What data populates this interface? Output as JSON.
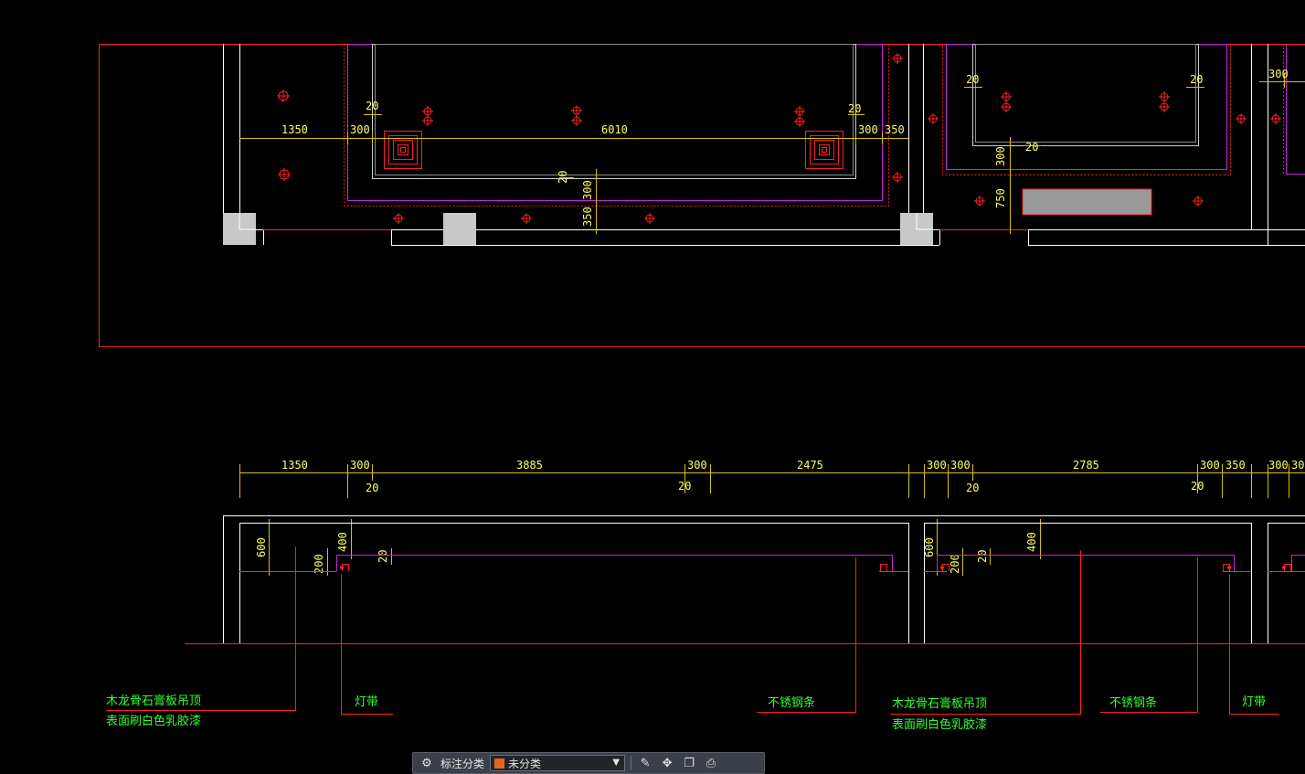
{
  "plan_dimensions": {
    "d1350": "1350",
    "d300a": "300",
    "d20a": "20",
    "d6010": "6010",
    "d20b": "20",
    "d300b": "300",
    "d350a": "350",
    "d20c": "20",
    "d300c": "300",
    "d350b": "350",
    "r20a": "20",
    "r20b": "20",
    "r20c": "20",
    "r300": "300",
    "r750": "750",
    "r300b": "300"
  },
  "section_dimensions": {
    "d1350": "1350",
    "d300a": "300",
    "d20a": "20",
    "d3885": "3885",
    "d300b": "300",
    "d20b": "20",
    "d2475": "2475",
    "d300c": "300",
    "d300d": "300",
    "d2785": "2785",
    "d300e": "300",
    "d20c": "20",
    "d350": "350",
    "d20d": "20",
    "d300f": "300",
    "d30": "30",
    "v600a": "600",
    "v400a": "400",
    "v200a": "200",
    "v20a": "20",
    "v600b": "600",
    "v200b": "200",
    "v20b": "20",
    "v400b": "400"
  },
  "annotations": {
    "ceiling_1_line1": "木龙骨石膏板吊顶",
    "ceiling_1_line2": "表面刷白色乳胶漆",
    "light_strip_1": "灯带",
    "stainless_1": "不锈钢条",
    "ceiling_2_line1": "木龙骨石膏板吊顶",
    "ceiling_2_line2": "表面刷白色乳胶漆",
    "stainless_2": "不锈钢条",
    "light_strip_2": "灯带"
  },
  "toolbar": {
    "category_label": "标注分类",
    "category_value": "未分类",
    "category_color": "#e8641e",
    "icons": [
      "filter-icon",
      "edit-icon",
      "move-icon",
      "copy-icon",
      "print-icon"
    ]
  },
  "colors": {
    "background": "#000000",
    "frame_red": "#ff2020",
    "wall_white": "#ffffff",
    "ceiling_magenta": "#d020e0",
    "dimension_yellow": "#ffff66",
    "note_green": "#33ff33",
    "column_gray": "#c8c8c8"
  }
}
